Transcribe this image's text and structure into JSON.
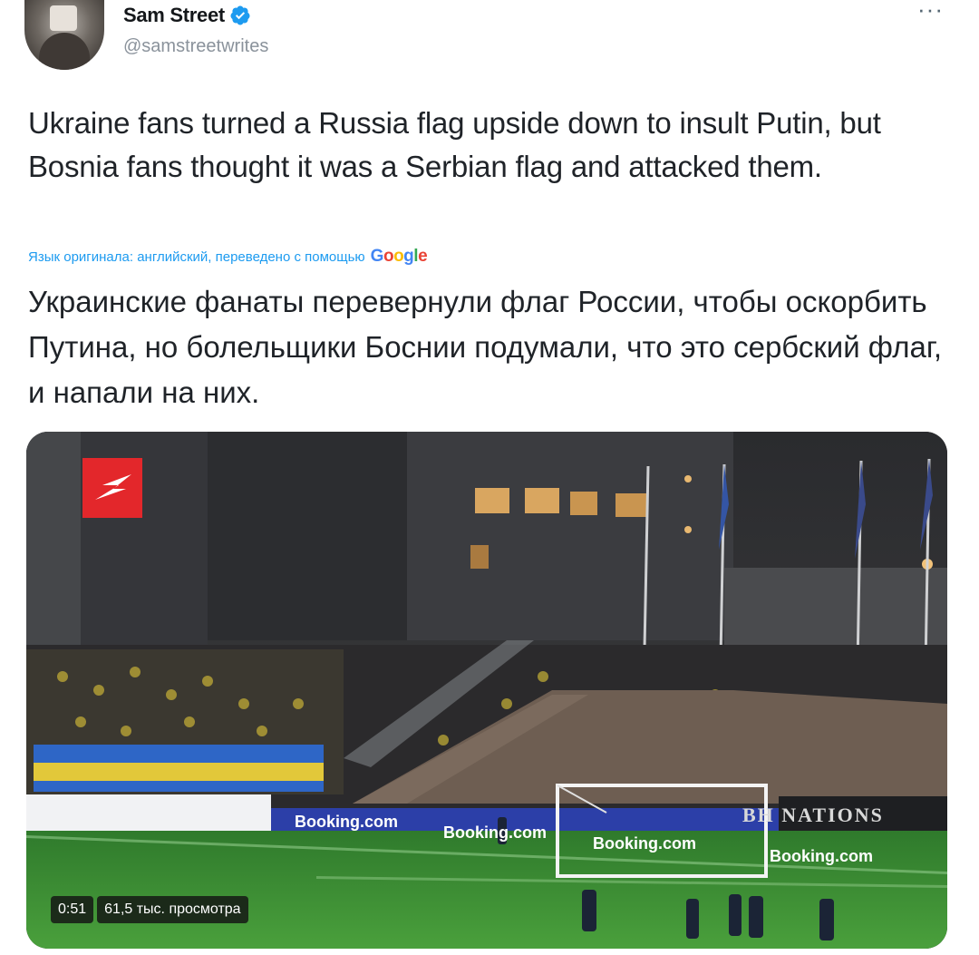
{
  "author": {
    "display_name": "Sam Street",
    "handle": "@samstreetwrites"
  },
  "tweet": {
    "text": "Ukraine fans turned a Russia flag upside down to insult Putin, but Bosnia fans thought it was a Serbian flag and attacked them.",
    "translation_note": "Язык оригинала: английский, переведено с помощью",
    "translation_provider": "Google",
    "translated_text": "Украинские фанаты перевернули флаг России, чтобы оскорбить Путина, но болельщики Боснии подумали, что это сербский флаг, и напали на них."
  },
  "video": {
    "duration": "0:51",
    "views": "61,5 тыс. просмотра",
    "ad_boards": [
      "Booking.com",
      "Booking.com",
      "Booking.com",
      "Booking.com"
    ],
    "banner_text": "BH NATIONS"
  },
  "colors": {
    "accent": "#1d9bf0",
    "verified": "#1d9bf0",
    "pitch": "#3f8f34",
    "ad_board": "#2c3fa8"
  },
  "icons": [
    "verified-badge-icon",
    "more-options-icon",
    "broadcaster-logo-icon"
  ]
}
